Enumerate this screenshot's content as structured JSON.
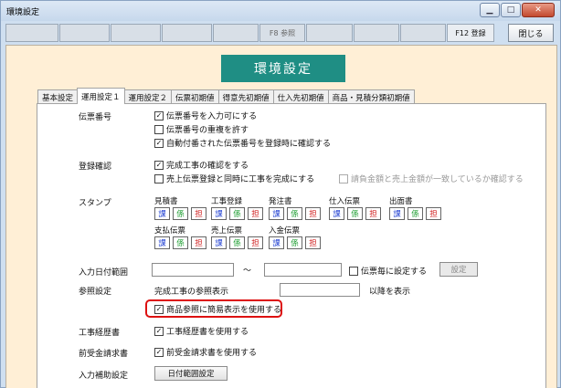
{
  "window": {
    "title": "環境設定"
  },
  "toolbar": {
    "fkeys": [
      "",
      "",
      "",
      "",
      "",
      "F8 参照",
      "",
      "",
      "",
      "F12 登録"
    ],
    "close_label": "閉じる"
  },
  "header": {
    "title": "環境設定"
  },
  "tabs": [
    "基本設定",
    "運用設定１",
    "運用設定２",
    "伝票初期値",
    "得意先初期値",
    "仕入先初期値",
    "商品・見積分類初期値"
  ],
  "sections": {
    "denpyo": {
      "label": "伝票番号",
      "options": [
        {
          "text": "伝票番号を入力可にする",
          "checked": true
        },
        {
          "text": "伝票番号の重複を許す",
          "checked": false
        },
        {
          "text": "自動付番された伝票番号を登録時に確認する",
          "checked": true
        }
      ]
    },
    "toroku": {
      "label": "登録確認",
      "options": [
        {
          "text": "完成工事の確認をする",
          "checked": true
        },
        {
          "text": "売上伝票登録と同時に工事を完成にする",
          "checked": false
        },
        {
          "text": "請負金額と売上金額が一致しているか確認する",
          "checked": false
        }
      ]
    },
    "stamp": {
      "label": "スタンプ",
      "chars": [
        "課",
        "係",
        "担"
      ],
      "names": [
        "見積書",
        "工事登録",
        "発注書",
        "仕入伝票",
        "出面書",
        "支払伝票",
        "売上伝票",
        "入金伝票"
      ]
    },
    "date_range": {
      "label": "入力日付範囲",
      "tilde": "～",
      "per_slip": {
        "text": "伝票毎に設定する",
        "checked": false
      },
      "settings_button": "設定"
    },
    "reference": {
      "label": "参照設定",
      "completed_label": "完成工事の参照表示",
      "after_label": "以降を表示",
      "simple_display": {
        "text": "商品参照に簡易表示を使用する",
        "checked": true
      }
    },
    "koji": {
      "label": "工事経歴書",
      "option": {
        "text": "工事経歴書を使用する",
        "checked": true
      }
    },
    "maeuke": {
      "label": "前受金請求書",
      "option": {
        "text": "前受金請求書を使用する",
        "checked": true
      }
    },
    "assist": {
      "label": "入力補助設定",
      "button": "日付範囲設定"
    }
  },
  "check_mark": "✓",
  "colors": {
    "header_bg": "#1f8e84",
    "client_bg": "#ffefd6",
    "highlight": "#dd1111"
  }
}
